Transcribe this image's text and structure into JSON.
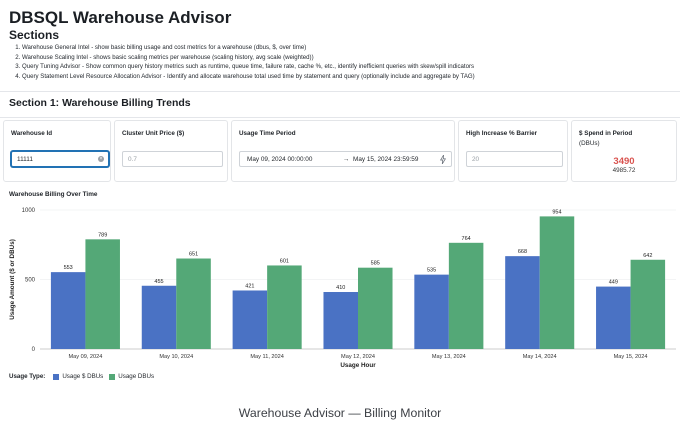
{
  "header": {
    "title": "DBSQL Warehouse Advisor",
    "sections_heading": "Sections",
    "sections": [
      "Warehouse General Intel - show basic billing usage and cost metrics for a warehouse (dbus, $, over time)",
      "Warehouse Scaling Intel - shows basic scaling metrics per warehouse (scaling history, avg scale (weighted))",
      "Query Tuning Advisor - Show common query history metrics such as runtime, queue time, failure rate, cache %, etc., identify inefficient queries with skew/spill indicators",
      "Query Statement Level Resource Allocation Advisor - Identify and allocate warehouse total used time by statement and query (optionally include and aggregate by TAG)"
    ]
  },
  "section1": {
    "title": "Section 1: Warehouse Billing Trends"
  },
  "filters": {
    "warehouse_id": {
      "label": "Warehouse Id",
      "value": "11111"
    },
    "unit_price": {
      "label": "Cluster Unit Price ($)",
      "placeholder": "0.7"
    },
    "time_period": {
      "label": "Usage Time Period",
      "start": "May 09, 2024 00:00:00",
      "arrow": "→",
      "end": "May 15, 2024 23:59:59"
    },
    "increase_barrier": {
      "label": "High Increase % Barrier",
      "placeholder": "20"
    },
    "spend": {
      "label": "$ Spend in Period",
      "sublabel": "(DBUs)",
      "value": "3490",
      "subvalue": "4985.72"
    }
  },
  "chart_title": "Warehouse Billing Over Time",
  "chart_data": {
    "type": "bar",
    "title": "Warehouse Billing Over Time",
    "xlabel": "Usage Hour",
    "ylabel": "Usage Amount ($ or DBUs)",
    "ylim": [
      0,
      1000
    ],
    "yticks": [
      "0",
      "500",
      "1000"
    ],
    "categories": [
      "May 09, 2024",
      "May 10, 2024",
      "May 11, 2024",
      "May 12, 2024",
      "May 13, 2024",
      "May 14, 2024",
      "May 15, 2024"
    ],
    "series": [
      {
        "name": "Usage $ DBUs",
        "color": "#4a72c4",
        "values": [
          553,
          455,
          421,
          410,
          535,
          668,
          449
        ]
      },
      {
        "name": "Usage DBUs",
        "color": "#54a877",
        "values": [
          789,
          651,
          601,
          585,
          764,
          954,
          642
        ]
      }
    ],
    "legend_title": "Usage Type:",
    "legend_position": "bottom-left",
    "grid": true
  },
  "caption": "Warehouse Advisor — Billing Monitor",
  "icons": {
    "clear": "clear-circle-icon",
    "timezone": "lightning-icon"
  }
}
